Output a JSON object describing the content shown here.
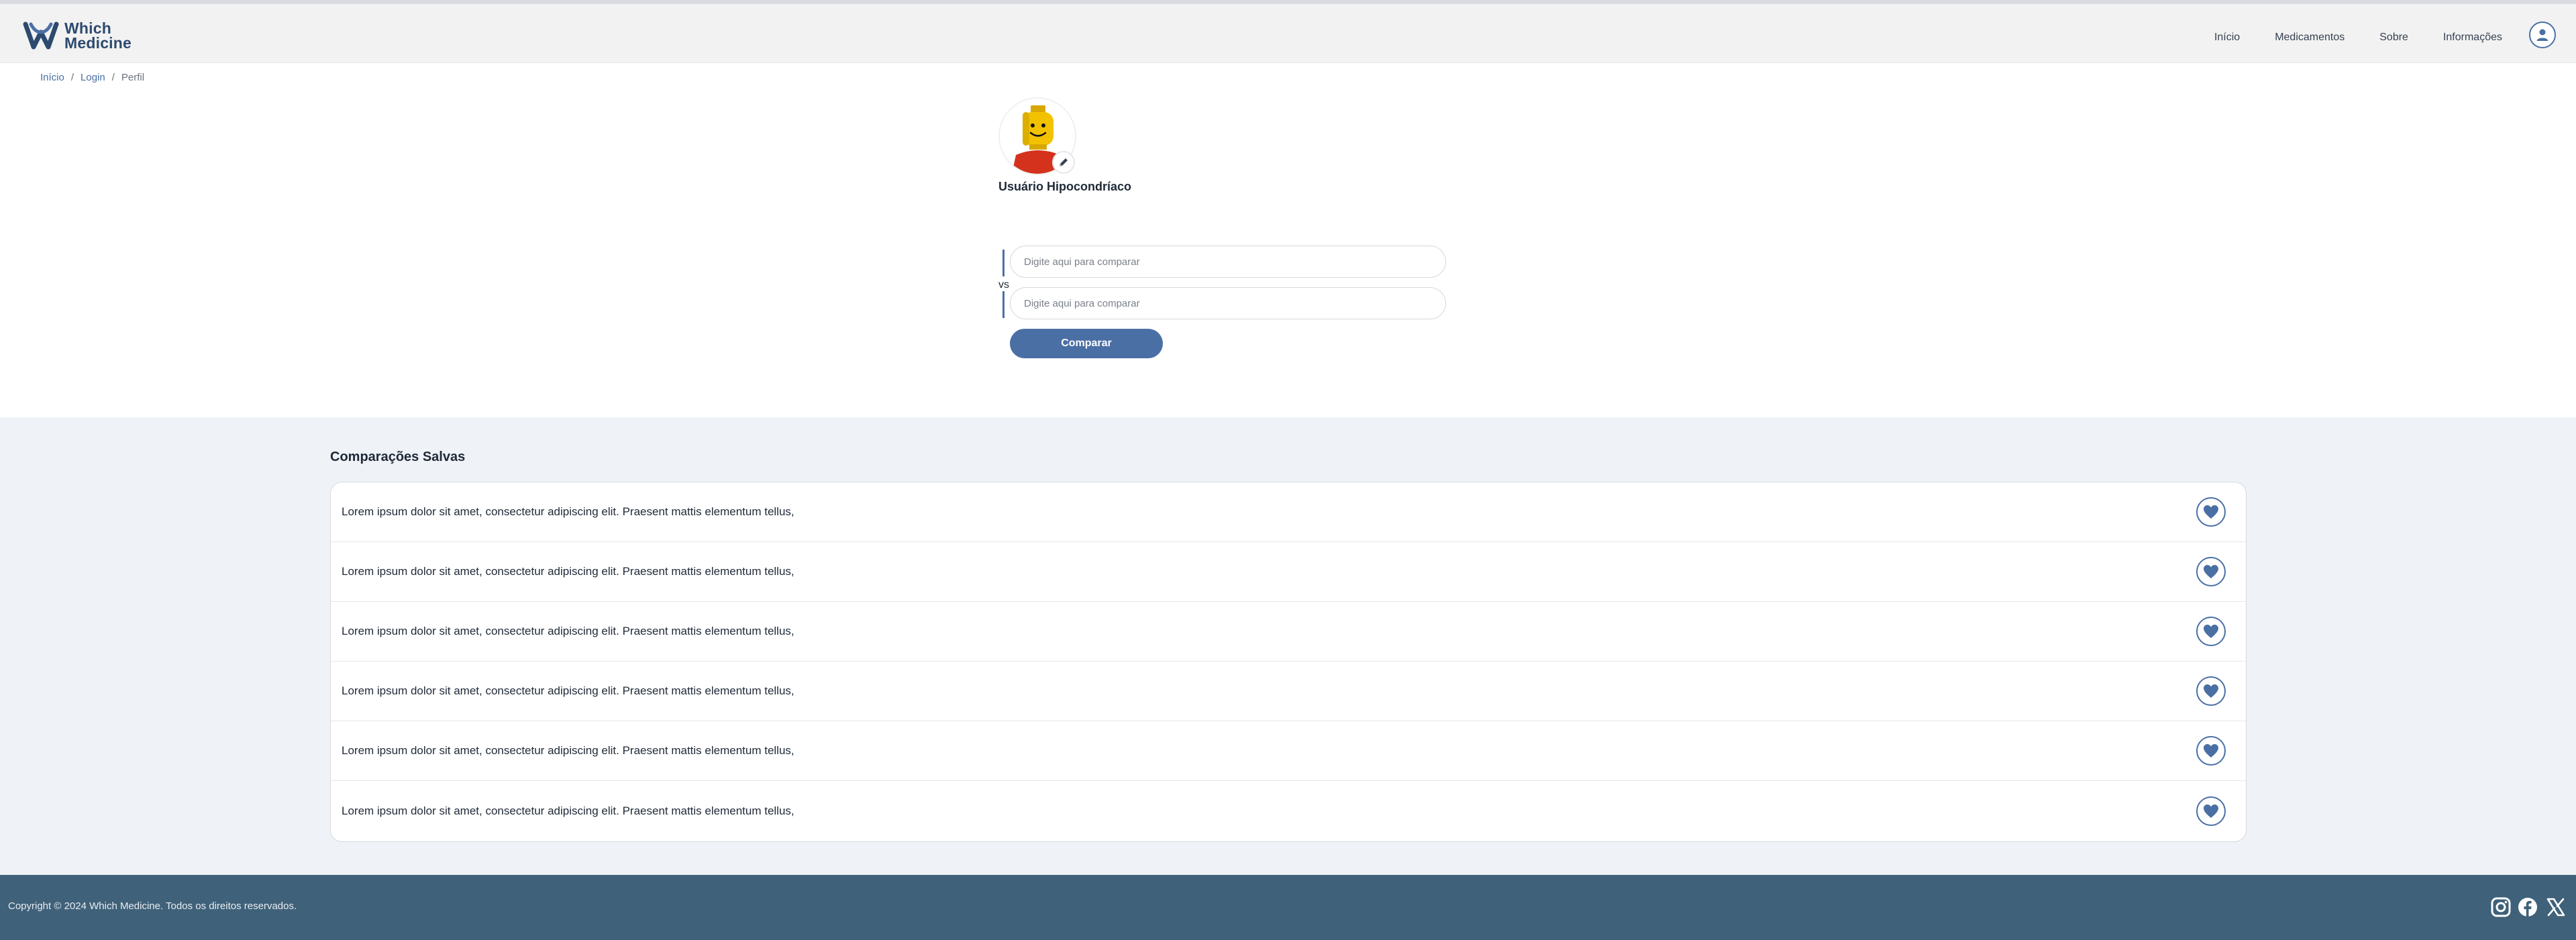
{
  "brand": {
    "line1": "Which",
    "line2": "Medicine"
  },
  "nav": {
    "items": [
      "Início",
      "Medicamentos",
      "Sobre",
      "Informações"
    ]
  },
  "breadcrumb": {
    "home": "Início",
    "login": "Login",
    "current": "Perfil",
    "separator": "/"
  },
  "profile": {
    "username": "Usuário Hipocondríaco"
  },
  "compare": {
    "placeholder1": "Digite aqui para comparar",
    "placeholder2": "Digite aqui para comparar",
    "vs": "vs",
    "button": "Comparar"
  },
  "saved": {
    "title": "Comparações Salvas",
    "items": [
      "Lorem ipsum dolor sit amet, consectetur adipiscing elit. Praesent mattis elementum tellus,",
      "Lorem ipsum dolor sit amet, consectetur adipiscing elit. Praesent mattis elementum tellus,",
      "Lorem ipsum dolor sit amet, consectetur adipiscing elit. Praesent mattis elementum tellus,",
      "Lorem ipsum dolor sit amet, consectetur adipiscing elit. Praesent mattis elementum tellus,",
      "Lorem ipsum dolor sit amet, consectetur adipiscing elit. Praesent mattis elementum tellus,",
      "Lorem ipsum dolor sit amet, consectetur adipiscing elit. Praesent mattis elementum tellus,"
    ]
  },
  "footer": {
    "copyright": "Copyright © 2024 Which Medicine. Todos os direitos reservados."
  },
  "icons": {
    "user": "user-circle-icon",
    "edit": "pencil-icon",
    "heart": "heart-icon",
    "instagram": "instagram-icon",
    "facebook": "facebook-icon",
    "x": "x-twitter-icon"
  },
  "colors": {
    "primary": "#4a6fa5",
    "footer": "#3f6179",
    "section_bg": "#eff2f6",
    "brand_text": "#2c4a6e"
  }
}
